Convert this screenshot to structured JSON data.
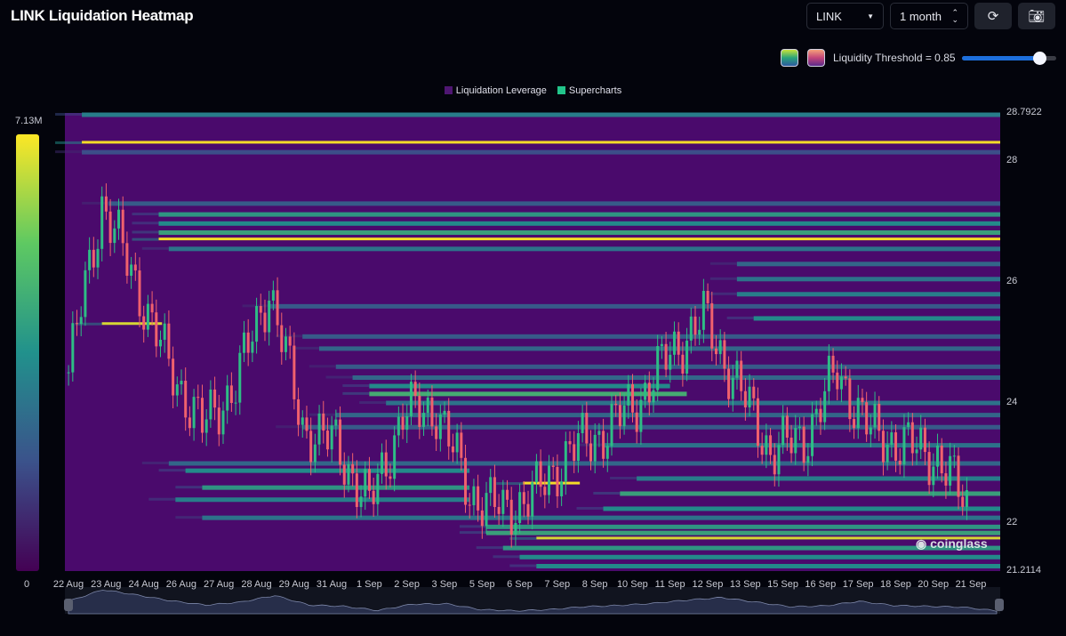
{
  "header": {
    "title": "LINK Liquidation Heatmap",
    "symbol": "LINK",
    "period": "1 month",
    "refresh_icon": "refresh-icon",
    "camera_icon": "camera-icon"
  },
  "controls": {
    "threshold_label": "Liquidity Threshold = 0.85",
    "threshold_value": 0.85
  },
  "watermark": "coinglass",
  "chart_data": {
    "type": "heatmap",
    "title": "LINK Liquidation Heatmap",
    "legend": [
      "Liquidation Leverage",
      "Supercharts"
    ],
    "legend_placement": "top-center",
    "colorbar": {
      "max_label": "7.13M",
      "min_label": "0",
      "colors": [
        "#440154",
        "#3b528b",
        "#21918c",
        "#5ec962",
        "#fde725"
      ]
    },
    "y_ticks": [
      "28.7922",
      "28",
      "26",
      "24",
      "22",
      "21.2114"
    ],
    "y_tick_values": [
      28.7922,
      28,
      26,
      24,
      22,
      21.2114
    ],
    "ylim": [
      21.2114,
      28.7922
    ],
    "x_ticks": [
      "22 Aug",
      "23 Aug",
      "24 Aug",
      "26 Aug",
      "27 Aug",
      "28 Aug",
      "29 Aug",
      "31 Aug",
      "1 Sep",
      "2 Sep",
      "3 Sep",
      "5 Sep",
      "6 Sep",
      "7 Sep",
      "8 Sep",
      "10 Sep",
      "11 Sep",
      "12 Sep",
      "13 Sep",
      "15 Sep",
      "16 Sep",
      "17 Sep",
      "18 Sep",
      "20 Sep",
      "21 Sep"
    ],
    "price_path": [
      24.5,
      27.3,
      26.0,
      24.6,
      23.6,
      24.3,
      25.9,
      23.6,
      23.3,
      22.3,
      23.8,
      23.9,
      22.5,
      22.2,
      22.5,
      23.2,
      23.5,
      24.0,
      24.8,
      25.4,
      24.3,
      23.2,
      23.4,
      24.5,
      23.5,
      23.3,
      23.1,
      22.2
    ],
    "bands": [
      {
        "price": 28.77,
        "from": 0.4,
        "to": 28,
        "v": 0.45
      },
      {
        "price": 28.3,
        "from": 0.4,
        "to": 28,
        "v": 1.0
      },
      {
        "price": 28.15,
        "from": 0.4,
        "to": 28,
        "v": 0.25
      },
      {
        "price": 27.3,
        "from": 1.2,
        "to": 28,
        "v": 0.3
      },
      {
        "price": 27.12,
        "from": 2.7,
        "to": 28,
        "v": 0.55
      },
      {
        "price": 26.97,
        "from": 2.7,
        "to": 28,
        "v": 0.5
      },
      {
        "price": 26.82,
        "from": 2.7,
        "to": 28,
        "v": 0.6
      },
      {
        "price": 26.7,
        "from": 2.7,
        "to": 28,
        "v": 1.0
      },
      {
        "price": 26.55,
        "from": 3,
        "to": 28,
        "v": 0.4
      },
      {
        "price": 26.3,
        "from": 20,
        "to": 28,
        "v": 0.35
      },
      {
        "price": 26.05,
        "from": 20,
        "to": 28,
        "v": 0.4
      },
      {
        "price": 25.8,
        "from": 20,
        "to": 28,
        "v": 0.45
      },
      {
        "price": 25.6,
        "from": 6,
        "to": 28,
        "v": 0.3
      },
      {
        "price": 25.4,
        "from": 20.5,
        "to": 28,
        "v": 0.5
      },
      {
        "price": 25.3,
        "from": 1,
        "to": 2.8,
        "v": 0.95
      },
      {
        "price": 25.1,
        "from": 7,
        "to": 28,
        "v": 0.3
      },
      {
        "price": 24.9,
        "from": 7.5,
        "to": 28,
        "v": 0.35
      },
      {
        "price": 24.6,
        "from": 8,
        "to": 28,
        "v": 0.3
      },
      {
        "price": 24.42,
        "from": 8.5,
        "to": 28,
        "v": 0.35
      },
      {
        "price": 24.28,
        "from": 9,
        "to": 18,
        "v": 0.5
      },
      {
        "price": 24.15,
        "from": 9,
        "to": 18.5,
        "v": 0.65
      },
      {
        "price": 24.0,
        "from": 9.5,
        "to": 28,
        "v": 0.4
      },
      {
        "price": 23.8,
        "from": 8,
        "to": 28,
        "v": 0.35
      },
      {
        "price": 23.6,
        "from": 7,
        "to": 28,
        "v": 0.3
      },
      {
        "price": 23.3,
        "from": 16,
        "to": 28,
        "v": 0.4
      },
      {
        "price": 23.0,
        "from": 3,
        "to": 28,
        "v": 0.35
      },
      {
        "price": 22.88,
        "from": 3.5,
        "to": 12,
        "v": 0.5
      },
      {
        "price": 22.75,
        "from": 17,
        "to": 28,
        "v": 0.45
      },
      {
        "price": 22.66,
        "from": 13.6,
        "to": 15.3,
        "v": 1.0
      },
      {
        "price": 22.6,
        "from": 4,
        "to": 12,
        "v": 0.55
      },
      {
        "price": 22.5,
        "from": 16.5,
        "to": 28,
        "v": 0.6
      },
      {
        "price": 22.4,
        "from": 3.2,
        "to": 12,
        "v": 0.45
      },
      {
        "price": 22.25,
        "from": 16,
        "to": 28,
        "v": 0.5
      },
      {
        "price": 22.1,
        "from": 4,
        "to": 28,
        "v": 0.4
      },
      {
        "price": 21.95,
        "from": 12.5,
        "to": 28,
        "v": 0.55
      },
      {
        "price": 21.85,
        "from": 12.5,
        "to": 28,
        "v": 0.6
      },
      {
        "price": 21.75,
        "from": 14,
        "to": 28,
        "v": 0.95
      },
      {
        "price": 21.6,
        "from": 13,
        "to": 28,
        "v": 0.55
      },
      {
        "price": 21.45,
        "from": 13.5,
        "to": 28,
        "v": 0.5
      },
      {
        "price": 21.3,
        "from": 14,
        "to": 28,
        "v": 0.5
      }
    ]
  }
}
